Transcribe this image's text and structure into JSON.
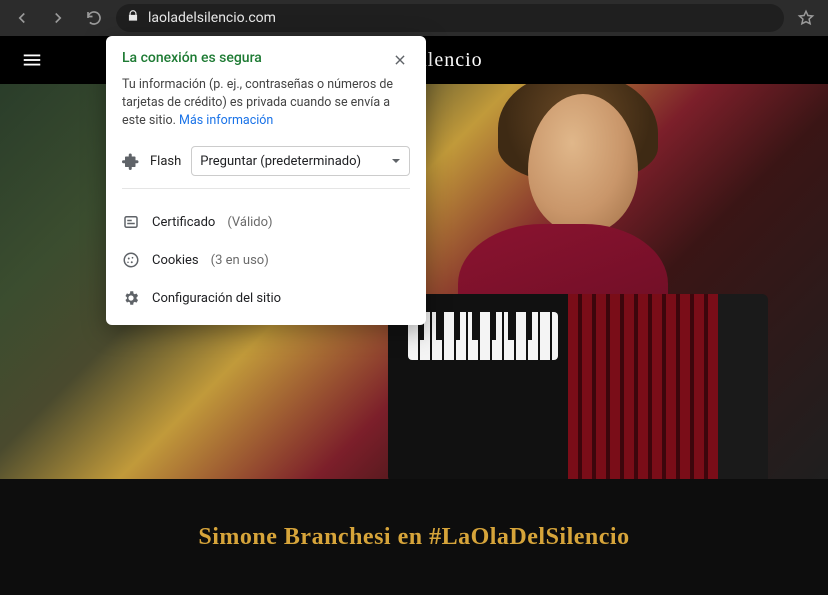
{
  "browser": {
    "url": "laoladelsilencio.com"
  },
  "site": {
    "brand_partial_visible": "OlaDelSilencio",
    "section_title": "Simone Branchesi en #LaOlaDelSilencio"
  },
  "popover": {
    "title": "La conexión es segura",
    "description": "Tu información (p. ej., contraseñas o números de tarjetas de crédito) es privada cuando se envía a este sitio. ",
    "more_info": "Más información",
    "flash_label": "Flash",
    "flash_select_value": "Preguntar (predeterminado)",
    "certificate_label": "Certificado",
    "certificate_status": "(Válido)",
    "cookies_label": "Cookies",
    "cookies_status": "(3 en uso)",
    "site_settings_label": "Configuración del sitio"
  }
}
